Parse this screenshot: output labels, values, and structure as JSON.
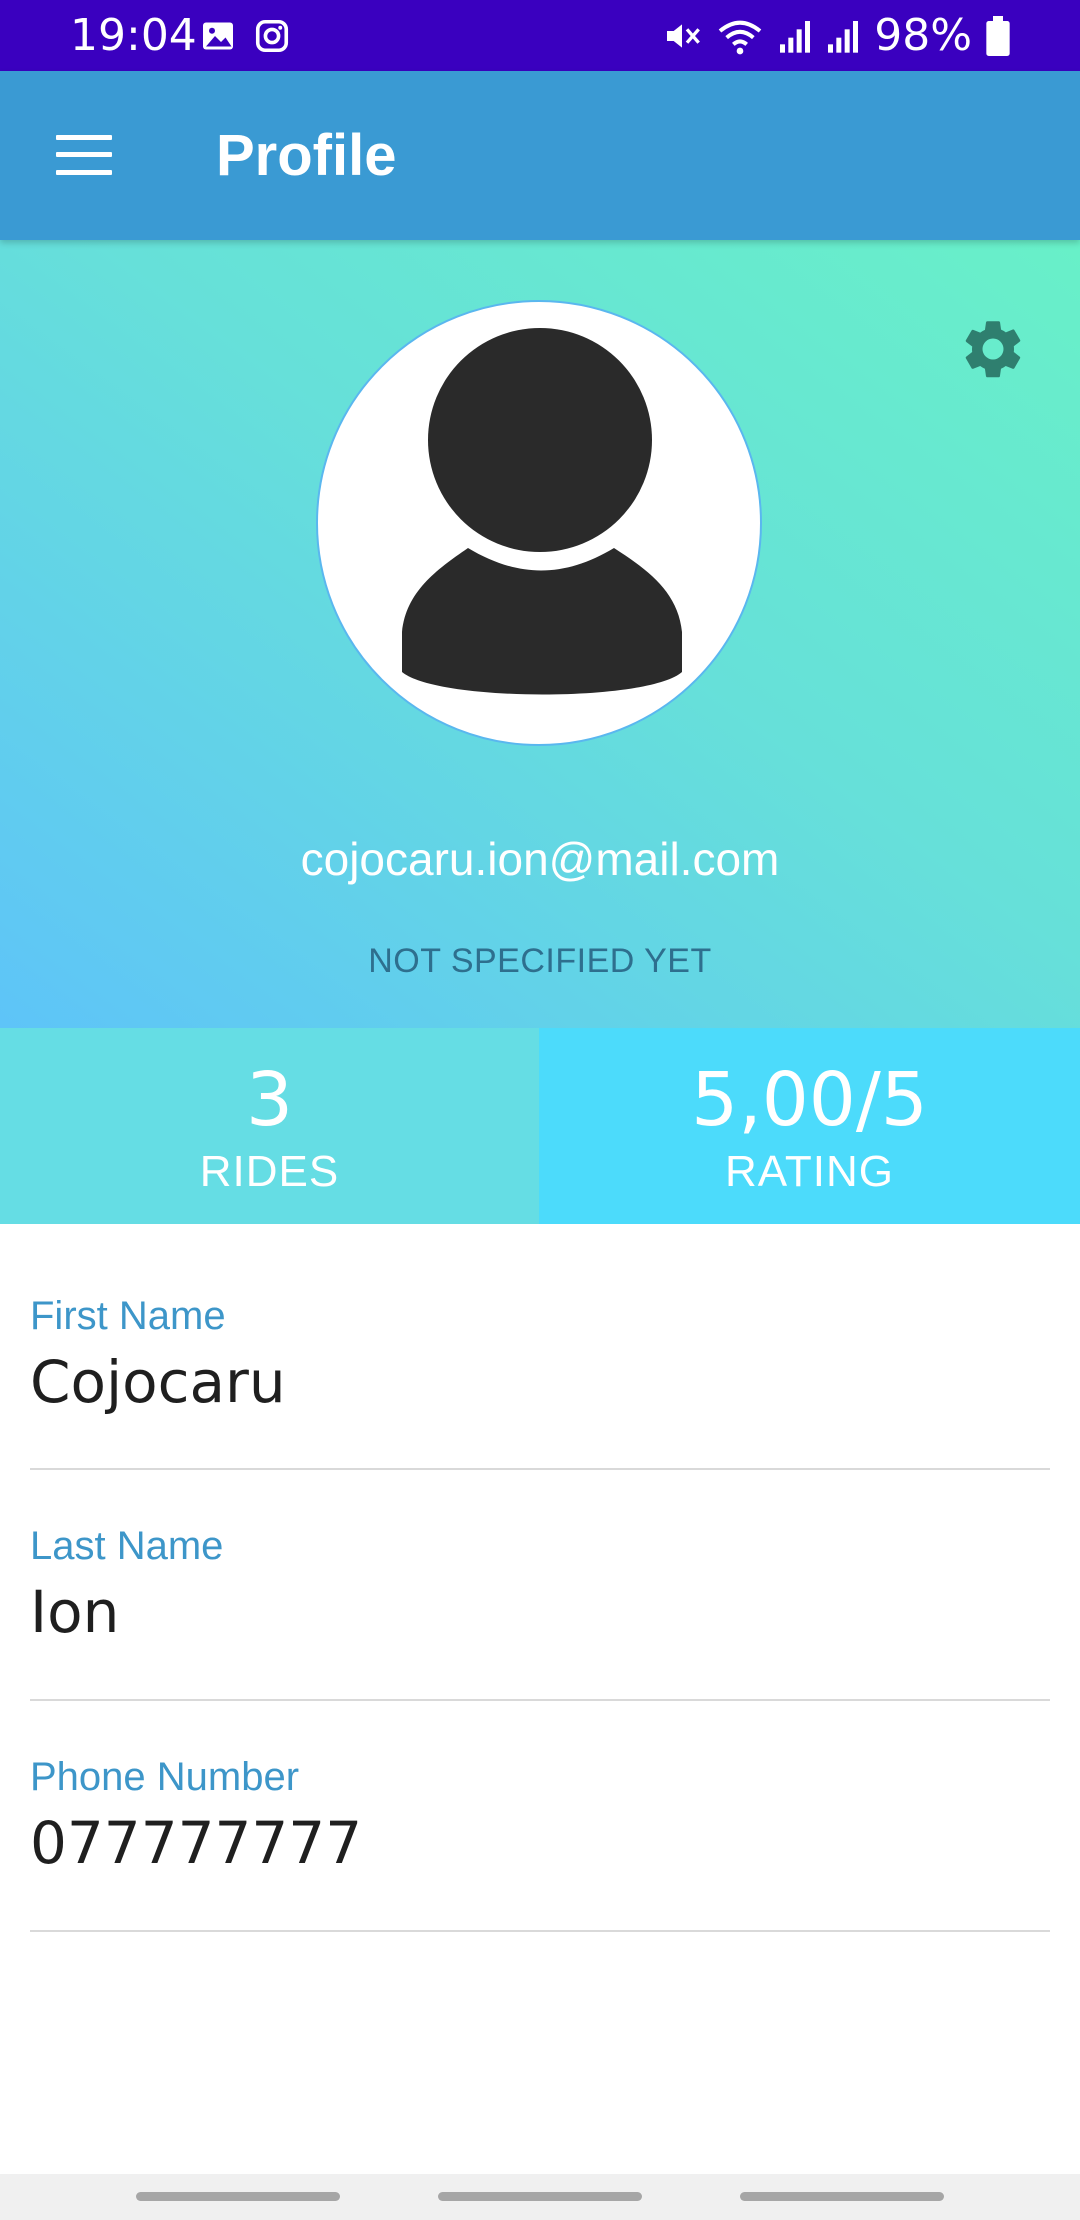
{
  "status_bar": {
    "time": "19:04",
    "battery": "98%",
    "background": "#3a00bf"
  },
  "app_bar": {
    "title": "Profile",
    "background": "#3a9ad3"
  },
  "profile": {
    "email": "cojocaru.ion@mail.com",
    "subtitle": "NOT SPECIFIED YET"
  },
  "stats": {
    "rides": {
      "value": "3",
      "label": "RIDES"
    },
    "rating": {
      "value": "5,00/5",
      "label": "RATING"
    }
  },
  "fields": [
    {
      "label": "First Name",
      "value": "Cojocaru"
    },
    {
      "label": "Last Name",
      "value": "Ion"
    },
    {
      "label": "Phone Number",
      "value": "077777777"
    }
  ],
  "icons": {
    "menu": "menu-icon",
    "settings": "gear-icon",
    "avatar": "person-icon"
  },
  "colors": {
    "accent": "#3d96c9",
    "rides_bg": "#65dde4",
    "rating_bg": "#4cdbfb",
    "gear": "#2f7f6f"
  }
}
